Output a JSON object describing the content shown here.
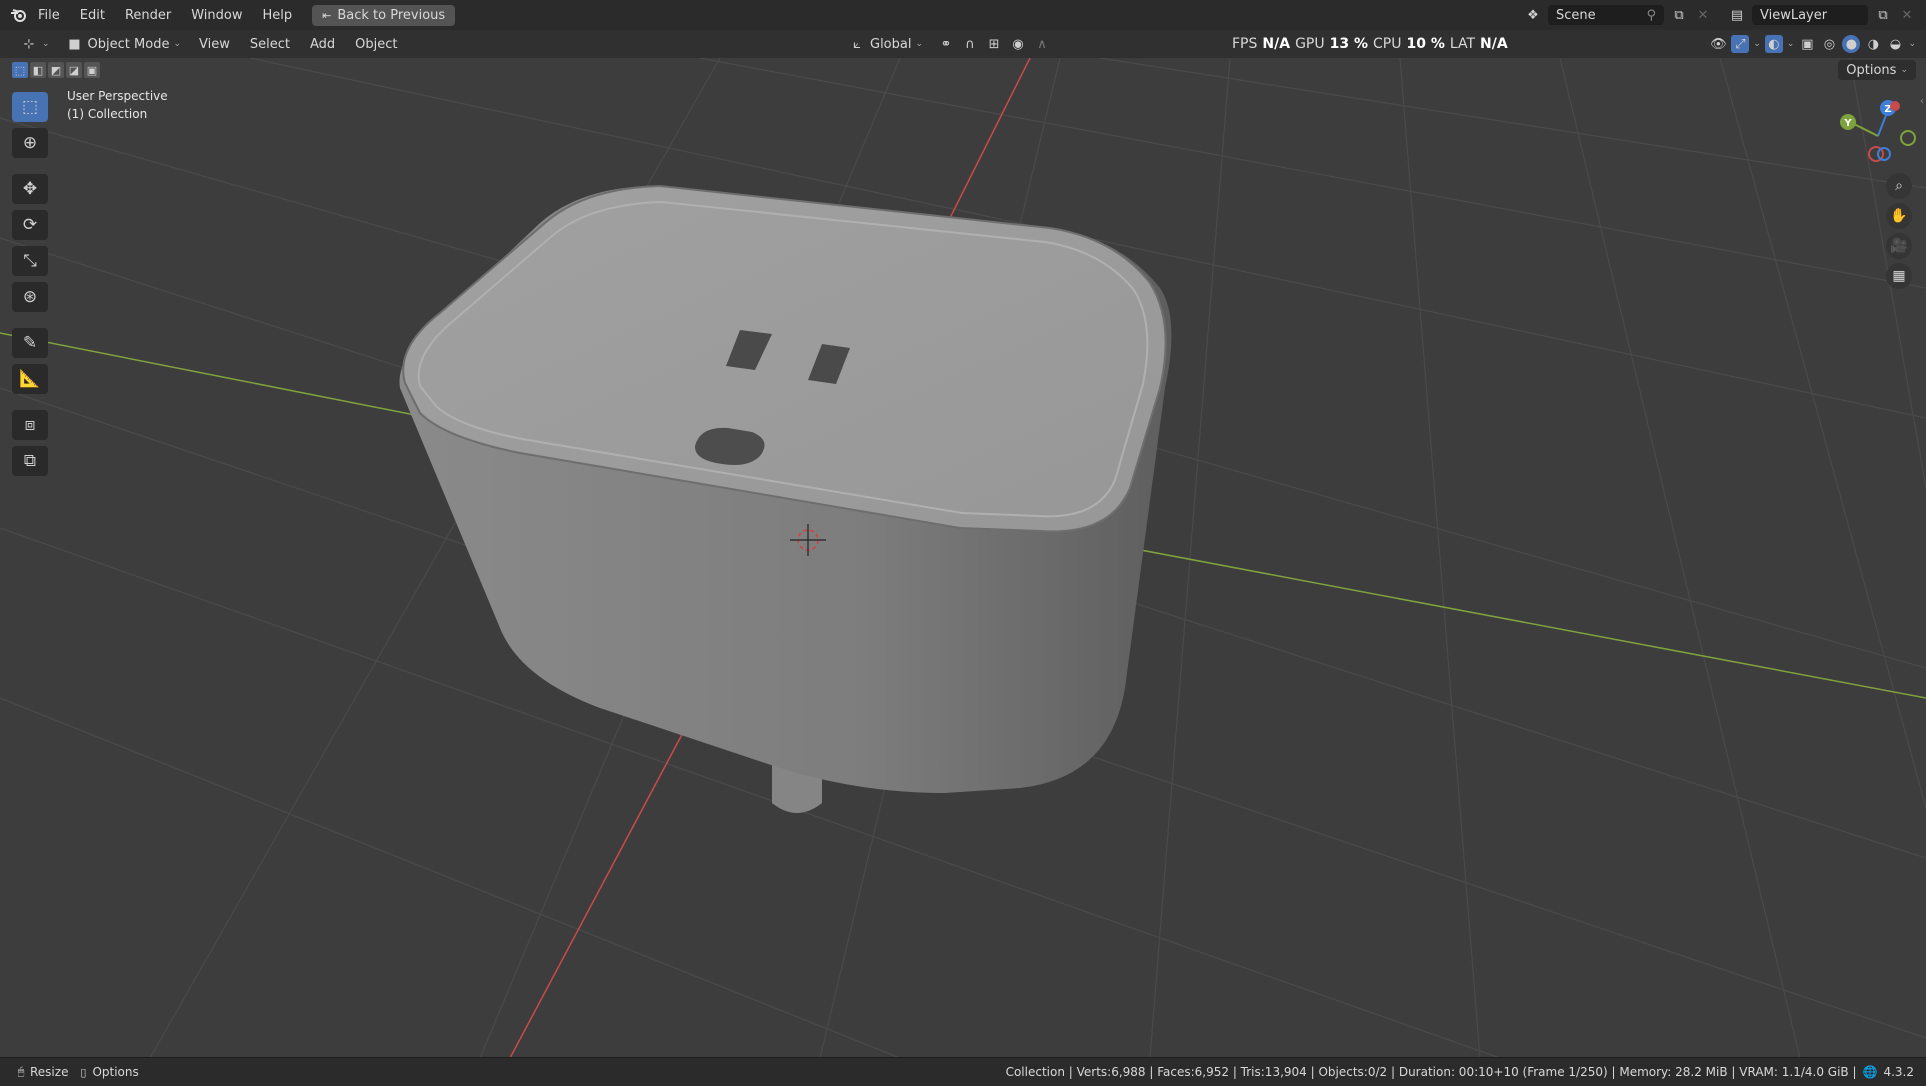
{
  "topbar": {
    "menus": [
      "File",
      "Edit",
      "Render",
      "Window",
      "Help"
    ],
    "back_button": "Back to Previous",
    "scene_name": "Scene",
    "view_layer": "ViewLayer"
  },
  "header": {
    "mode": "Object Mode",
    "menus": [
      "View",
      "Select",
      "Add",
      "Object"
    ],
    "transform_orientation": "Global",
    "options_label": "Options"
  },
  "stats": {
    "fps_label": "FPS",
    "fps_value": "N/A",
    "gpu_label": "GPU",
    "gpu_value": "13 %",
    "cpu_label": "CPU",
    "cpu_value": "10 %",
    "lat_label": "LAT",
    "lat_value": "N/A"
  },
  "viewport": {
    "perspective": "User Perspective",
    "collection": "(1) Collection",
    "gizmo_axes": [
      "Z",
      "Y",
      "X"
    ]
  },
  "toolbar": {
    "tools": [
      "select-box",
      "cursor",
      "move",
      "rotate",
      "scale",
      "transform",
      "annotate",
      "measure",
      "add-cube",
      "extrude"
    ]
  },
  "statusbar": {
    "left_resize": "Resize",
    "left_options": "Options",
    "info": "Collection | Verts:6,988 | Faces:6,952 | Tris:13,904 | Objects:0/2 | Duration: 00:10+10 (Frame 1/250) | Memory: 28.2 MiB | VRAM: 1.1/4.0 GiB |",
    "version": "4.3.2"
  },
  "colors": {
    "accent": "#4772b3",
    "x_axis": "#c94a4a",
    "y_axis": "#7fa33c",
    "z_axis": "#3d7fd9",
    "model": "#8e8e8e"
  }
}
